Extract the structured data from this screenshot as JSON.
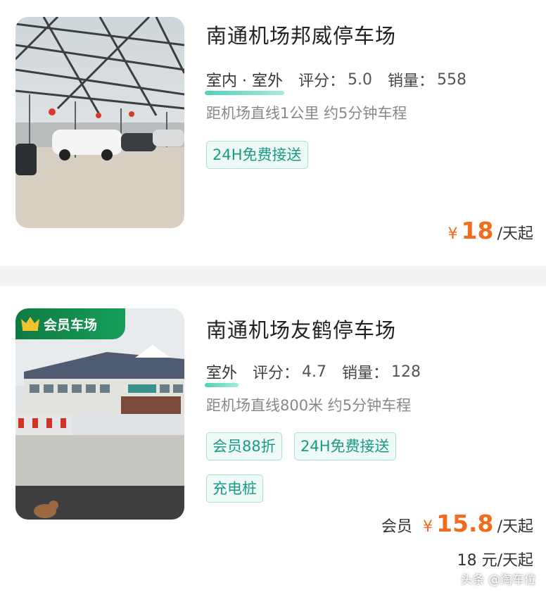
{
  "listings": [
    {
      "name": "南通机场邦威停车场",
      "env_label": "室内 · 室外",
      "rating_label": "评分：",
      "rating": "5.0",
      "sales_label": "销量：",
      "sales": "558",
      "distance": "距机场直线1公里 约5分钟车程",
      "tags": [
        "24H免费接送"
      ],
      "currency": "¥",
      "price": "18",
      "price_unit": "/天起"
    },
    {
      "badge": "会员车场",
      "name": "南通机场友鹤停车场",
      "env_label": "室外",
      "rating_label": "评分：",
      "rating": "4.7",
      "sales_label": "销量：",
      "sales": "128",
      "distance": "距机场直线800米 约5分钟车程",
      "tags": [
        "会员88折",
        "24H免费接送",
        "充电桩"
      ],
      "member_label": "会员",
      "currency": "¥",
      "price": "15.8",
      "price_unit": "/天起",
      "original_price": "18 元",
      "original_unit": "/天起"
    }
  ],
  "watermark": "头条 @淘车位",
  "colors": {
    "accent": "#f36b1c",
    "tag_text": "#1a9a83",
    "tag_border": "#a9e0d5",
    "badge": "#0e7a43"
  }
}
